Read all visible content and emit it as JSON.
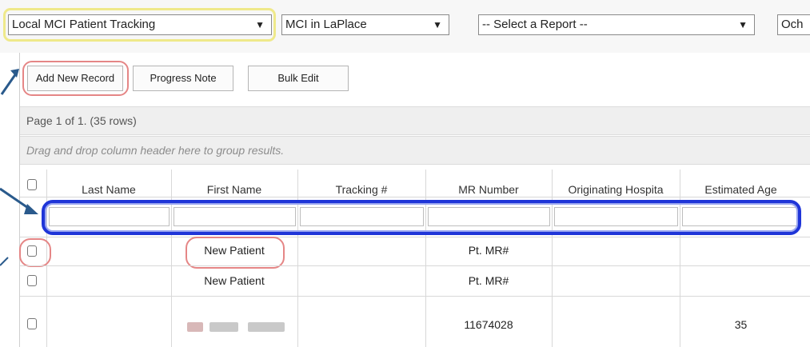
{
  "toolbar": {
    "tracking_select": "Local MCI Patient Tracking",
    "event_select": "MCI in LaPlace",
    "report_select": "-- Select a Report --",
    "partial_select": "Och"
  },
  "actions": {
    "add_new_record": "Add New Record",
    "progress_note": "Progress Note",
    "bulk_edit": "Bulk Edit"
  },
  "grid": {
    "pager": "Page 1 of 1. (35 rows)",
    "group_hint": "Drag and drop column header here to group results.",
    "columns": [
      "Last Name",
      "First Name",
      "Tracking #",
      "MR Number",
      "Originating Hospita",
      "Estimated Age"
    ],
    "rows": [
      {
        "last_name": "",
        "first_name": "New Patient",
        "tracking": "",
        "mr_number": "Pt. MR#",
        "hospital": "",
        "age": ""
      },
      {
        "last_name": "",
        "first_name": "New Patient",
        "tracking": "",
        "mr_number": "Pt. MR#",
        "hospital": "",
        "age": ""
      },
      {
        "last_name": "",
        "first_name": "",
        "tracking": "",
        "mr_number": "11674028",
        "hospital": "",
        "age": "35"
      }
    ]
  },
  "colors": {
    "highlight_yellow": "#efe98a",
    "highlight_red": "#e58686",
    "highlight_blue": "#1f35d8",
    "arrow": "#2a5a8c"
  },
  "icons": [
    "chevron-down-icon",
    "checkbox-icon",
    "arrow-icon"
  ]
}
